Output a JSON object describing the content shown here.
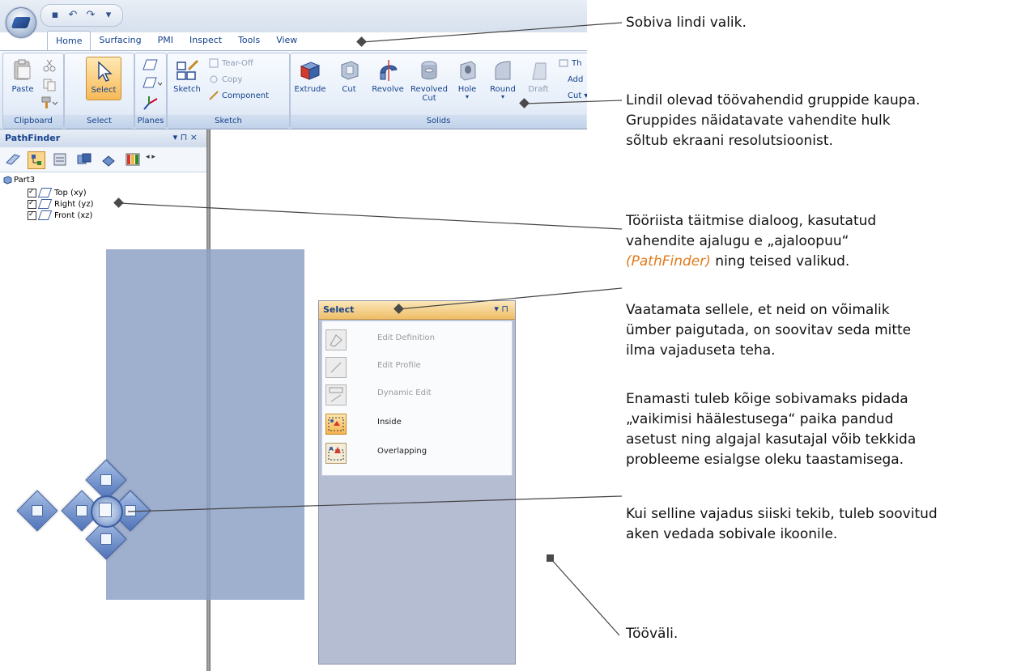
{
  "quick_access": {
    "save_icon": "save-icon",
    "undo_icon": "undo-icon",
    "redo_icon": "redo-icon"
  },
  "ribbon": {
    "tabs": [
      "Home",
      "Surfacing",
      "PMI",
      "Inspect",
      "Tools",
      "View"
    ],
    "active_tab": "Home",
    "groups": {
      "clipboard": {
        "label": "Clipboard",
        "paste": "Paste"
      },
      "select": {
        "label": "Select",
        "select": "Select"
      },
      "planes": {
        "label": "Planes"
      },
      "sketch": {
        "label": "Sketch",
        "sketch": "Sketch",
        "tear_off": "Tear-Off",
        "copy": "Copy",
        "component": "Component"
      },
      "solids": {
        "label": "Solids",
        "extrude": "Extrude",
        "cut": "Cut",
        "revolve": "Revolve",
        "revolved_cut_1": "Revolved",
        "revolved_cut_2": "Cut",
        "hole": "Hole",
        "round": "Round",
        "draft": "Draft",
        "extra_1": "Th",
        "extra_2": "Add",
        "extra_3": "Cut"
      }
    }
  },
  "pathfinder": {
    "title": "PathFinder",
    "controls": "▾ ⊓ ×",
    "tree": {
      "part": "Part3",
      "planes": [
        "Top (xy)",
        "Right (yz)",
        "Front (xz)"
      ]
    }
  },
  "select_panel": {
    "title": "Select",
    "items": [
      {
        "label": "Edit Definition",
        "enabled": false
      },
      {
        "label": "Edit Profile",
        "enabled": false
      },
      {
        "label": "Dynamic Edit",
        "enabled": false
      },
      {
        "label": "Inside",
        "enabled": true
      },
      {
        "label": "Overlapping",
        "enabled": true
      }
    ]
  },
  "annotations": {
    "ribbon_choice": "Sobiva lindi valik.",
    "tools_groups": [
      "Lindil olevad töövahendid gruppide kaupa.",
      "Gruppides näidatavate vahendite hulk",
      "sõltub ekraani resolutsioonist."
    ],
    "dialog_1": "Tööriista täitmise dialoog, kasutatud",
    "dialog_2": "vahendite ajalugu e „ajaloopuu“",
    "dialog_3_italic": "(PathFinder)",
    "dialog_3_rest": " ning teised valikud.",
    "rearrange": [
      "Vaatamata sellele, et neid on võimalik",
      "ümber paigutada, on soovitav seda mitte",
      "ilma vajaduseta teha."
    ],
    "default_layout": [
      "Enamasti tuleb kõige sobivamaks pidada",
      "„vaikimisi häälestusega“ paika pandud",
      "asetust ning algajal kasutajal võib tekkida",
      "probleeme esialgse oleku taastamisega."
    ],
    "drag_window": [
      "Kui selline vajadus siiski tekib, tuleb soovitud",
      "aken vedada sobivale ikoonile."
    ],
    "workspace": "Tööväli."
  }
}
